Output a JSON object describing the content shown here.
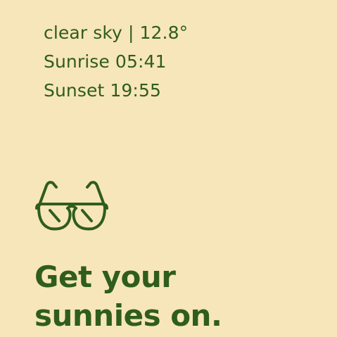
{
  "weather": {
    "condition_temp": "clear sky | 12.8°",
    "sunrise": "Sunrise 05:41",
    "sunset": "Sunset 19:55"
  },
  "icon": {
    "name": "sunglasses-icon",
    "color": "#2f5d1c"
  },
  "message": {
    "line1": "Get your",
    "line2": "sunnies on."
  },
  "colors": {
    "background": "#f7e6b9",
    "text": "#2f5d1c"
  }
}
